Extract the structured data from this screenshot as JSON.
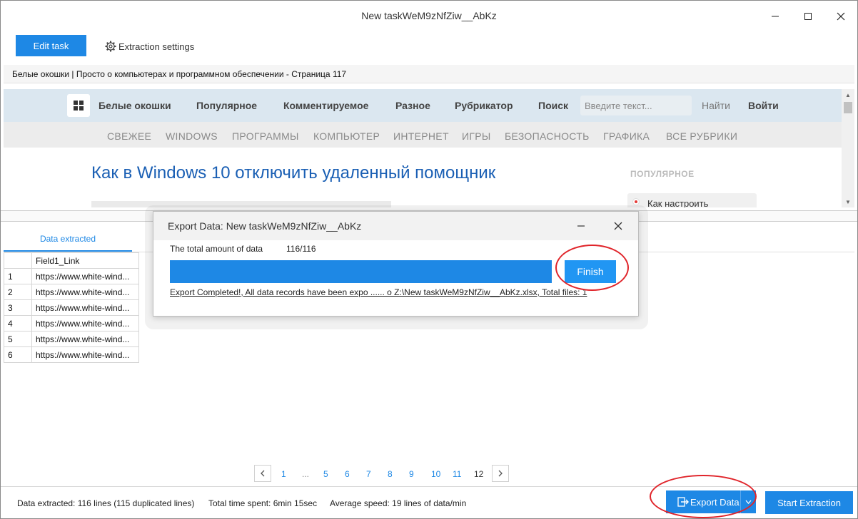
{
  "window": {
    "title": "New taskWeM9zNfZiw__AbKz"
  },
  "toolbar": {
    "edit_task_label": "Edit task",
    "extraction_settings_label": "Extraction settings"
  },
  "browser": {
    "page_title": "Белые окошки | Просто о компьютерах и программном обеспечении - Страница 117",
    "nav": [
      "Белые окошки",
      "Популярное",
      "Комментируемое",
      "Разное",
      "Рубрикатор",
      "Поиск"
    ],
    "search_placeholder": "Введите текст...",
    "find_label": "Найти",
    "login_label": "Войти",
    "categories": [
      "СВЕЖЕЕ",
      "WINDOWS",
      "ПРОГРАММЫ",
      "КОМПЬЮТЕР",
      "ИНТЕРНЕТ",
      "ИГРЫ",
      "БЕЗОПАСНОСТЬ",
      "ГРАФИКА",
      "ВСЕ РУБРИКИ"
    ],
    "article_title": "Как в Windows 10 отключить удаленный помощник",
    "popular_heading": "ПОПУЛЯРНОЕ",
    "popular_item": "Как настроить"
  },
  "tabs": {
    "data_extracted": "Data extracted"
  },
  "table": {
    "header": "Field1_Link",
    "rows": [
      {
        "index": "1",
        "value": "https://www.white-wind..."
      },
      {
        "index": "2",
        "value": "https://www.white-wind..."
      },
      {
        "index": "3",
        "value": "https://www.white-wind..."
      },
      {
        "index": "4",
        "value": "https://www.white-wind..."
      },
      {
        "index": "5",
        "value": "https://www.white-wind..."
      },
      {
        "index": "6",
        "value": "https://www.white-wind..."
      }
    ]
  },
  "pagination": {
    "pages": [
      "1",
      "...",
      "5",
      "6",
      "7",
      "8",
      "9",
      "10",
      "11",
      "12"
    ],
    "current": "12"
  },
  "status": {
    "lines": "Data extracted: 116 lines (115 duplicated lines)",
    "time": "Total time spent: 6min 15sec",
    "speed": "Average speed: 19 lines of data/min"
  },
  "buttons": {
    "export_data": "Export Data",
    "start_extraction": "Start Extraction"
  },
  "dialog": {
    "title": "Export Data: New taskWeM9zNfZiw__AbKz",
    "total_label": "The total amount of data",
    "total_value": "116/116",
    "progress": 1.0,
    "finish_label": "Finish",
    "message": "Export Completed!, All data records have been expo ...... o Z:\\New taskWeM9zNfZiw__AbKz.xlsx, Total files: 1"
  },
  "colors": {
    "accent": "#1e88e5",
    "annotation": "#e0242a"
  }
}
